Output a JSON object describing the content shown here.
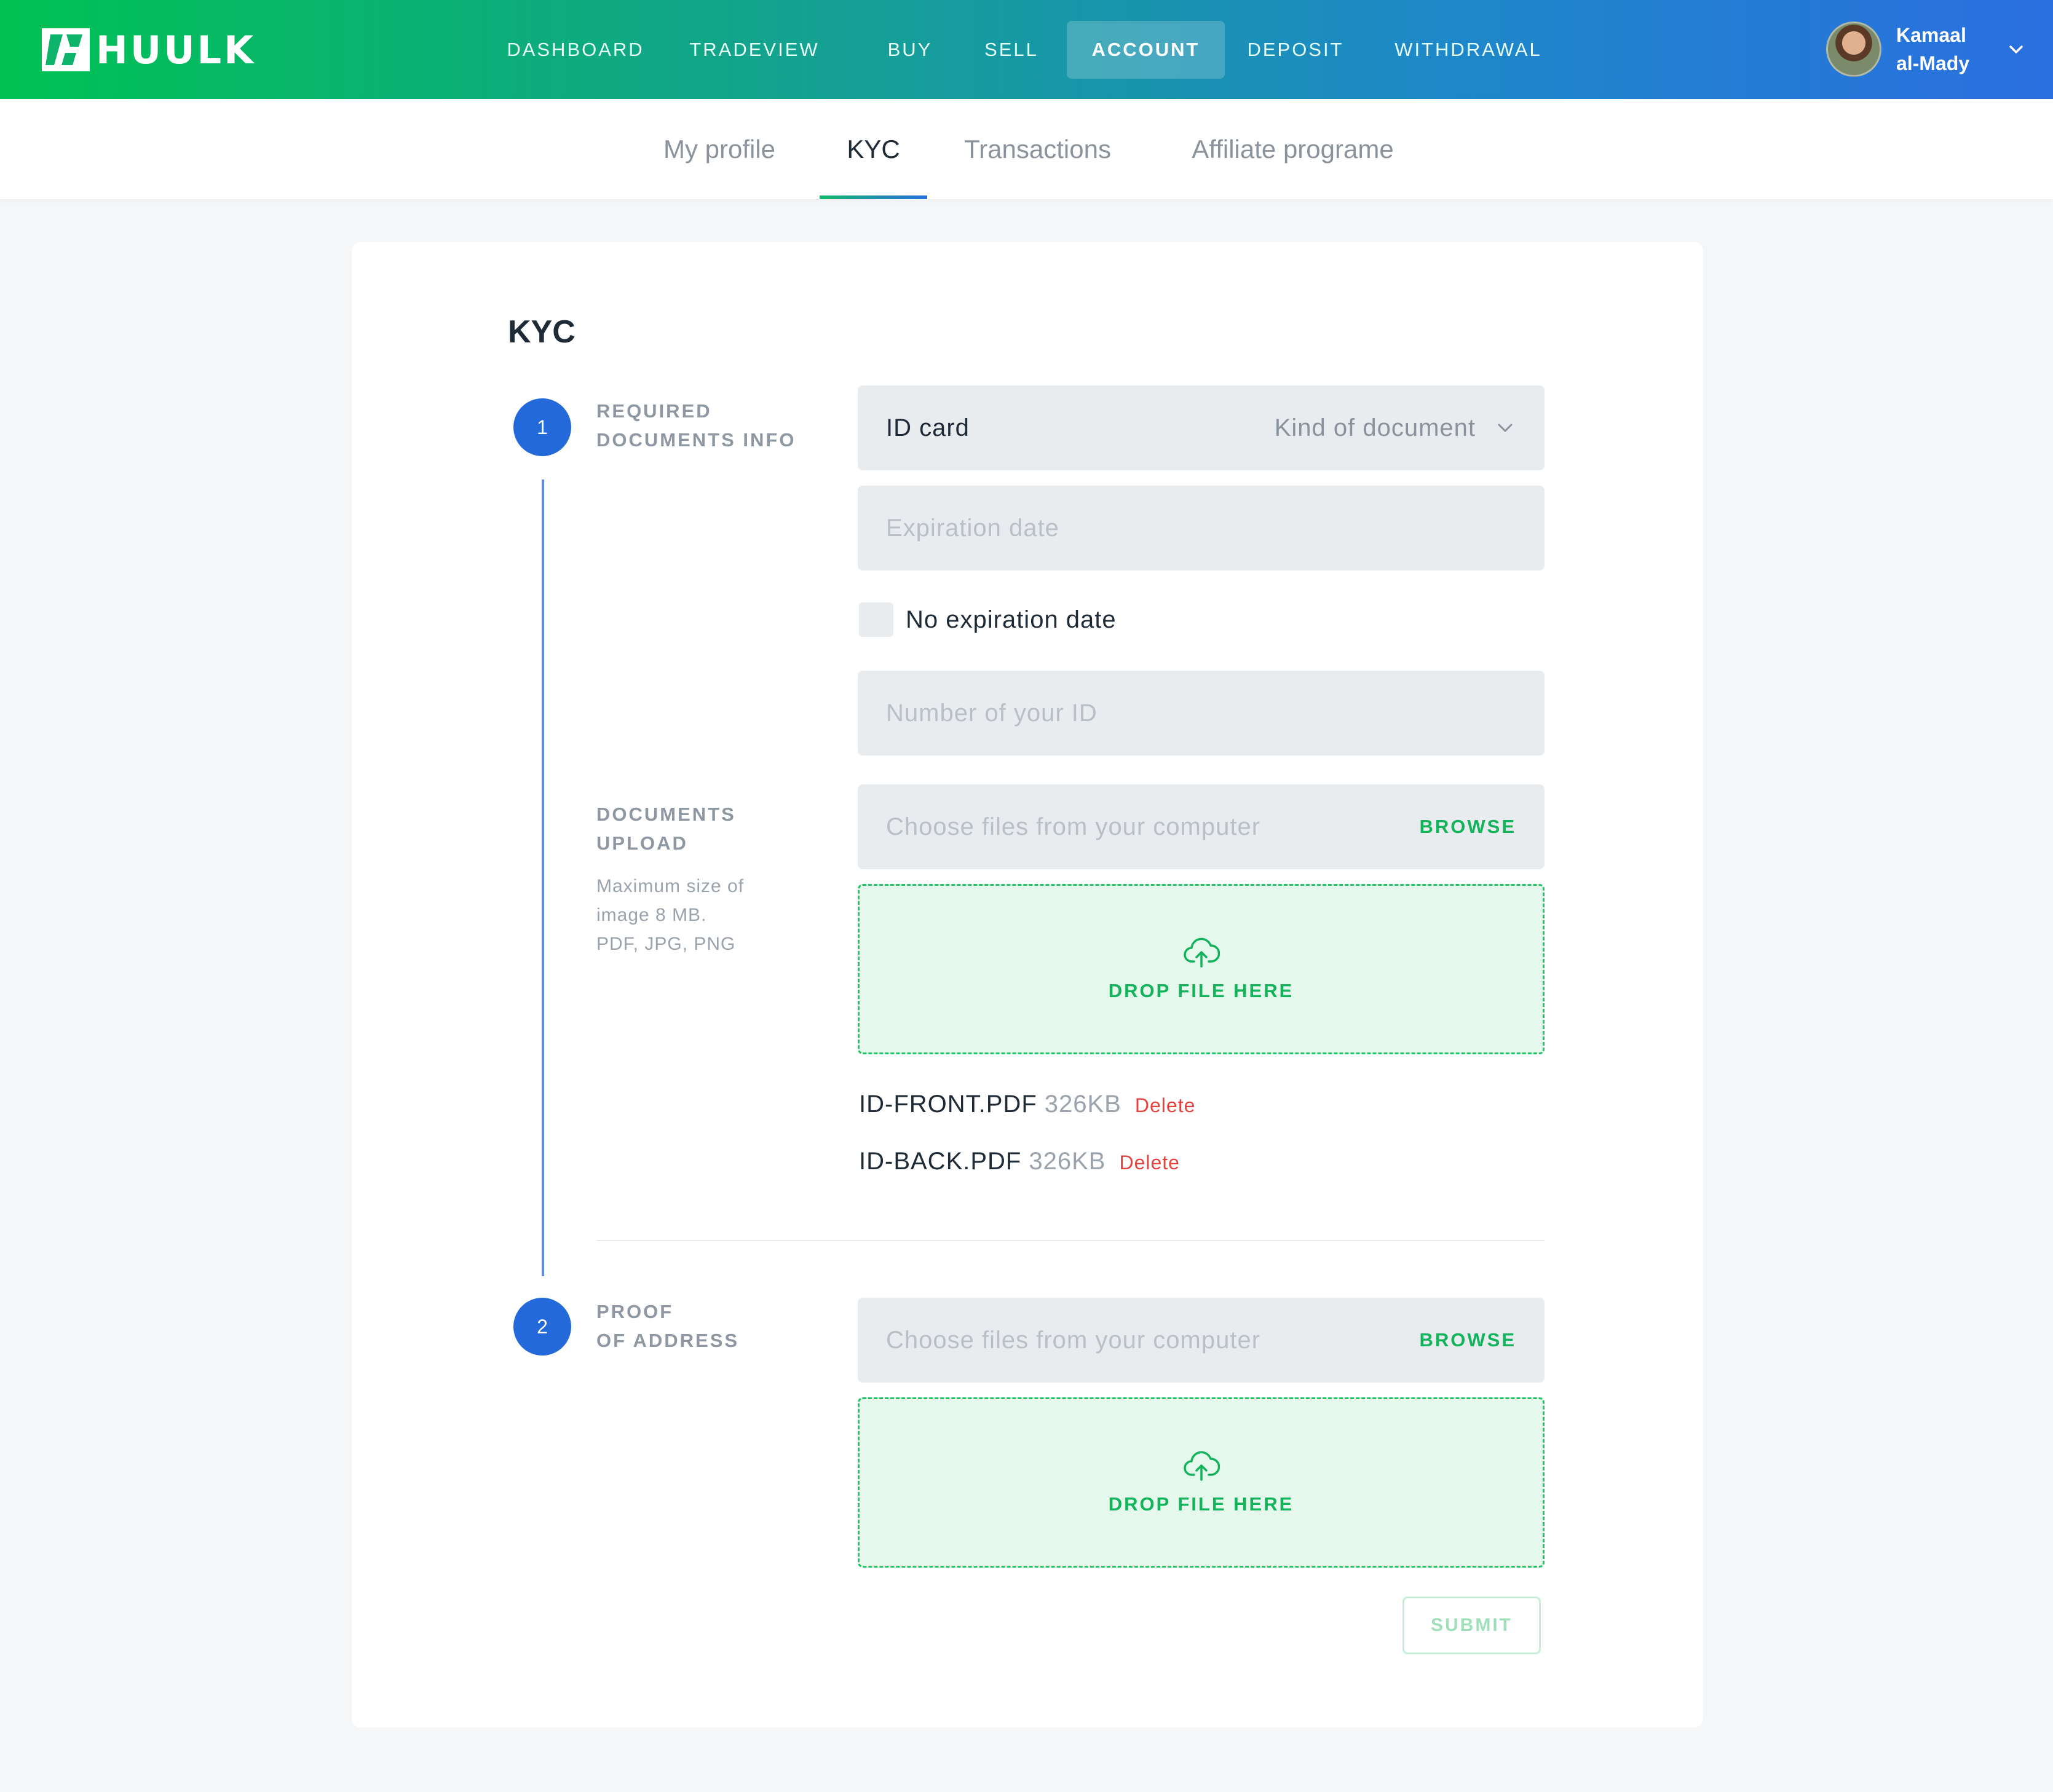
{
  "brand": {
    "name": "HUULK"
  },
  "nav": {
    "items": [
      {
        "label": "DASHBOARD"
      },
      {
        "label": "TRADEVIEW"
      },
      {
        "label": "BUY"
      },
      {
        "label": "SELL"
      },
      {
        "label": "ACCOUNT",
        "active": true
      },
      {
        "label": "DEPOSIT"
      },
      {
        "label": "WITHDRAWAL"
      }
    ]
  },
  "user": {
    "first_name": "Kamaal",
    "last_name": "al-Mady"
  },
  "subtabs": [
    {
      "label": "My profile"
    },
    {
      "label": "KYC",
      "active": true
    },
    {
      "label": "Transactions"
    },
    {
      "label": "Affiliate programe"
    }
  ],
  "kyc": {
    "title": "KYC",
    "step1": {
      "number": "1",
      "label_line1": "REQUIRED",
      "label_line2": "DOCUMENTS INFO",
      "document_type": {
        "value": "ID card",
        "hint": "Kind of document"
      },
      "expiration_date": {
        "placeholder": "Expiration date"
      },
      "no_expiration": {
        "label": "No expiration date",
        "checked": false
      },
      "id_number": {
        "placeholder": "Number of your ID"
      },
      "upload": {
        "label_line1": "DOCUMENTS",
        "label_line2": "UPLOAD",
        "note_line1": "Maximum size of",
        "note_line2": "image 8 MB.",
        "note_line3": "PDF, JPG, PNG",
        "browse_placeholder": "Choose files from your computer",
        "browse_label": "BROWSE",
        "drop_label": "DROP FILE HERE",
        "files": [
          {
            "name": "ID-FRONT.PDF",
            "size": "326KB",
            "delete_label": "Delete"
          },
          {
            "name": "ID-BACK.PDF",
            "size": "326KB",
            "delete_label": "Delete"
          }
        ]
      }
    },
    "step2": {
      "number": "2",
      "label_line1": "PROOF",
      "label_line2": "OF ADDRESS",
      "browse_placeholder": "Choose files from your computer",
      "browse_label": "BROWSE",
      "drop_label": "DROP FILE HERE"
    },
    "submit_label": "SUBMIT"
  },
  "colors": {
    "primary_blue": "#2469d9",
    "accent_green": "#13b35c",
    "delete_red": "#e8423f"
  }
}
